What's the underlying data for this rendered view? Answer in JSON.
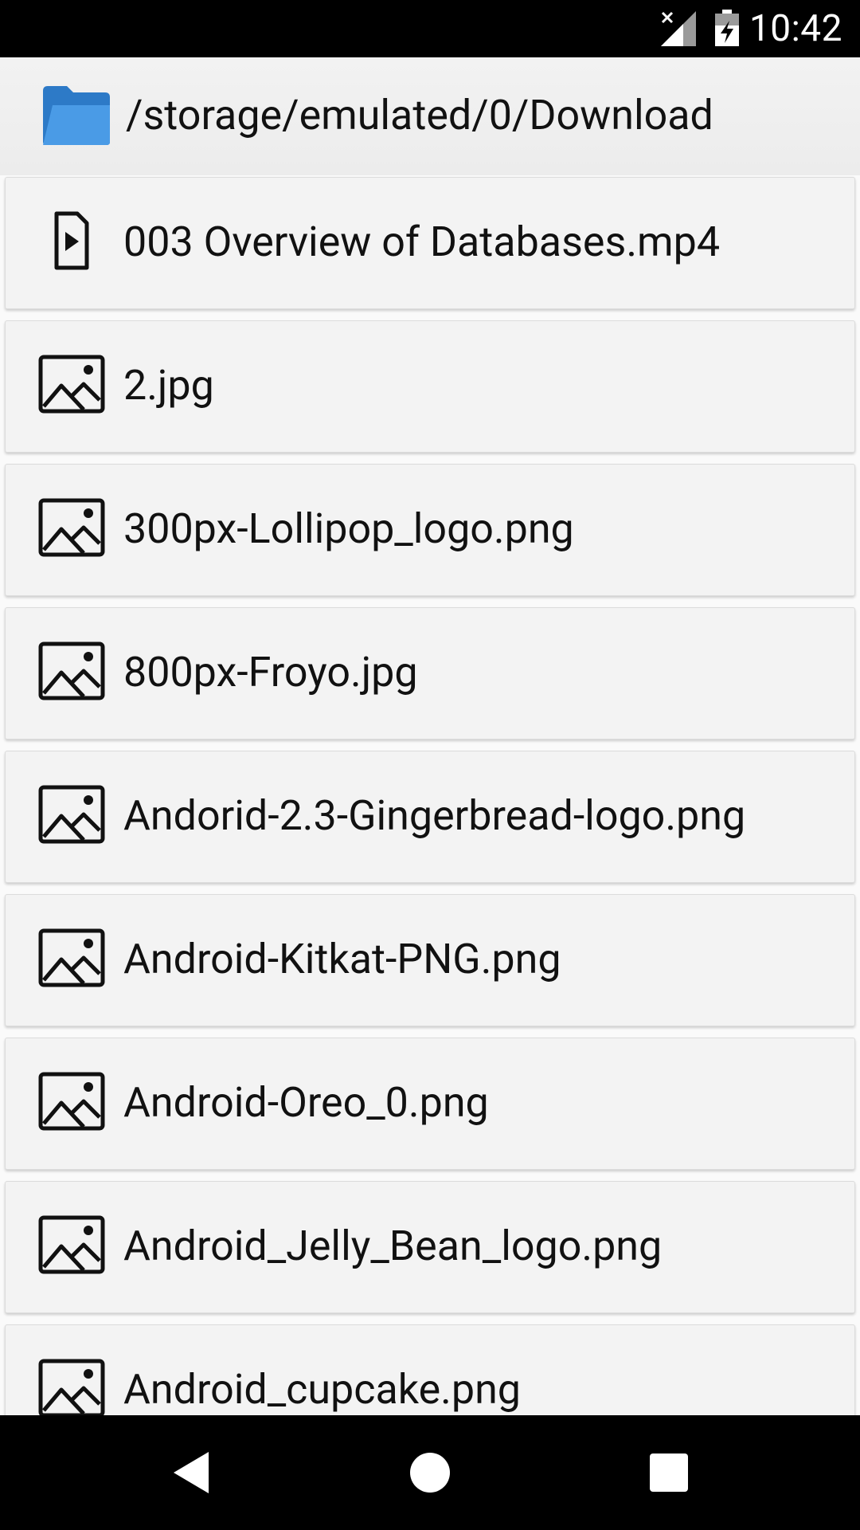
{
  "status_bar": {
    "time": "10:42",
    "icons": [
      "signal-no-sim-icon",
      "battery-charging-icon"
    ]
  },
  "header": {
    "icon": "folder-open-icon",
    "path": "/storage/emulated/0/Download"
  },
  "files": [
    {
      "name": "003 Overview of Databases.mp4",
      "icon": "video-file-icon"
    },
    {
      "name": "2.jpg",
      "icon": "image-file-icon"
    },
    {
      "name": "300px-Lollipop_logo.png",
      "icon": "image-file-icon"
    },
    {
      "name": "800px-Froyo.jpg",
      "icon": "image-file-icon"
    },
    {
      "name": "Andorid-2.3-Gingerbread-logo.png",
      "icon": "image-file-icon"
    },
    {
      "name": "Android-Kitkat-PNG.png",
      "icon": "image-file-icon"
    },
    {
      "name": "Android-Oreo_0.png",
      "icon": "image-file-icon"
    },
    {
      "name": "Android_Jelly_Bean_logo.png",
      "icon": "image-file-icon"
    },
    {
      "name": "Android_cupcake.png",
      "icon": "image-file-icon"
    }
  ],
  "nav_bar": {
    "buttons": [
      "back-icon",
      "home-icon",
      "recents-icon"
    ]
  },
  "colors": {
    "folder": "#3d8ed9",
    "row_background": "#f3f3f3",
    "bars": "#000000"
  }
}
